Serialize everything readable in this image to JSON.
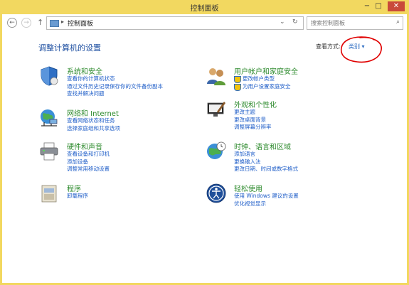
{
  "window": {
    "title": "控制面板",
    "controls": {
      "minimize": "−",
      "maximize": "□",
      "close": "✕"
    }
  },
  "addressbar": {
    "back": "←",
    "forward": "→",
    "up": "↑",
    "crumb_separator": "▸",
    "crumb": "控制面板",
    "dropdown": "⌄",
    "refresh": "↻"
  },
  "search": {
    "placeholder": "搜索控制面板",
    "icon_glyph": "⌕"
  },
  "page": {
    "heading": "调整计算机的设置",
    "view_by_label": "查看方式:",
    "view_by_value": "类别 ▾"
  },
  "categories_left": [
    {
      "title": "系统和安全",
      "icon": "shield-icon",
      "links": [
        "查看你的计算机状态",
        "通过文件历史记录保存你的文件备份副本",
        "查找并解决问题"
      ]
    },
    {
      "title": "网络和 Internet",
      "icon": "network-globe-icon",
      "links": [
        "查看网络状态和任务",
        "选择家庭组和共享选项"
      ]
    },
    {
      "title": "硬件和声音",
      "icon": "printer-icon",
      "links": [
        "查看设备和打印机",
        "添加设备",
        "调整常用移动设置"
      ]
    },
    {
      "title": "程序",
      "icon": "programs-icon",
      "links": [
        "卸载程序"
      ]
    }
  ],
  "categories_right": [
    {
      "title": "用户帐户和家庭安全",
      "icon": "users-icon",
      "links": [
        "更改帐户类型",
        "为用户设置家庭安全"
      ],
      "shield_links": true
    },
    {
      "title": "外观和个性化",
      "icon": "appearance-icon",
      "links": [
        "更改主题",
        "更改桌面背景",
        "调整屏幕分辨率"
      ]
    },
    {
      "title": "时钟、语言和区域",
      "icon": "clock-globe-icon",
      "links": [
        "添加语言",
        "更换输入法",
        "更改日期、时间或数字格式"
      ]
    },
    {
      "title": "轻松使用",
      "icon": "ease-of-access-icon",
      "links": [
        "使用 Windows 建议的设置",
        "优化视觉显示"
      ]
    }
  ],
  "colors": {
    "frame": "#f2d860",
    "link": "#1f5ec8",
    "category_title": "#2e8b2e",
    "heading": "#1e4fa1",
    "annotation": "#e00000"
  }
}
